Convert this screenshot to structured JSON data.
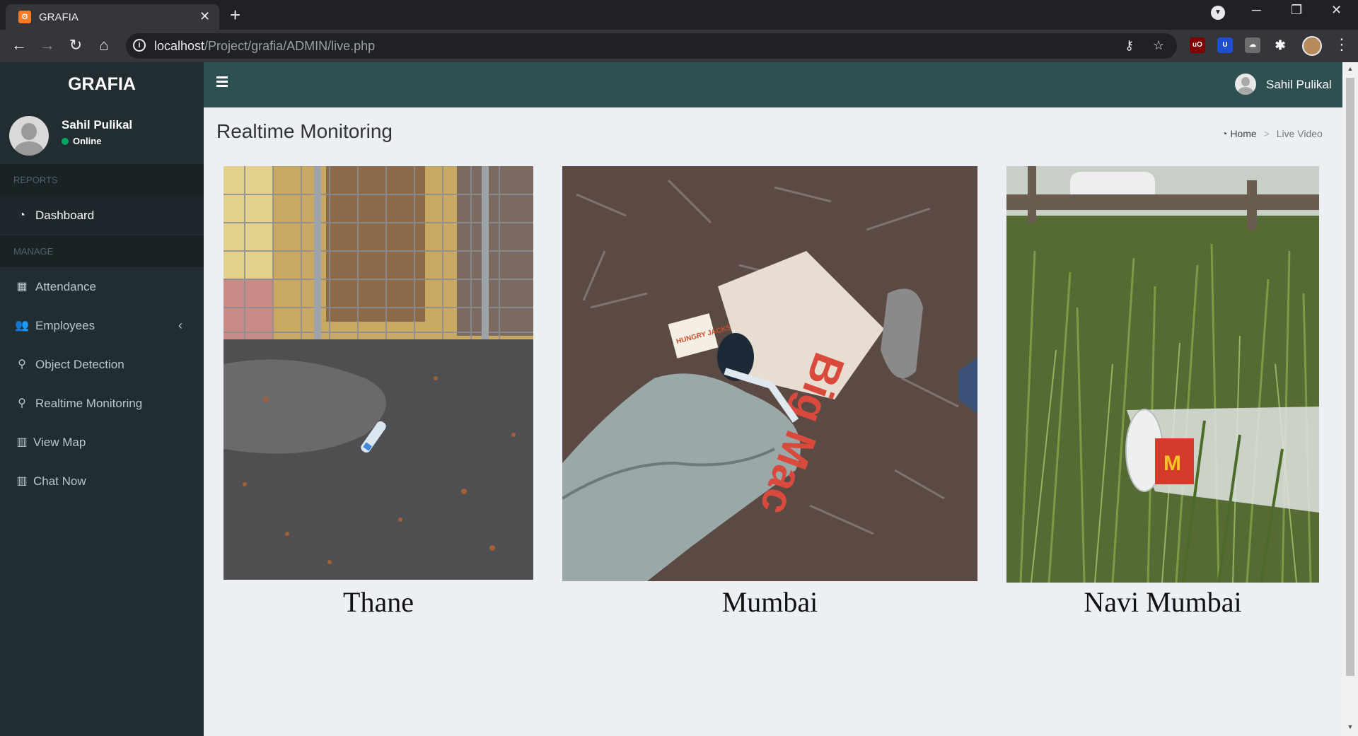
{
  "browser": {
    "tab_title": "GRAFIA",
    "tab_favicon_text": "ʘ",
    "url_host": "localhost",
    "url_path": "/Project/grafia/ADMIN/live.php"
  },
  "sidebar": {
    "brand": "GRAFIA",
    "user": {
      "name": "Sahil Pulikal",
      "status": "Online"
    },
    "sections": [
      {
        "header": "REPORTS"
      },
      {
        "header": "MANAGE"
      }
    ],
    "items": [
      {
        "label": "Dashboard",
        "icon": "dashboard-icon"
      },
      {
        "label": "Attendance",
        "icon": "calendar-icon"
      },
      {
        "label": "Employees",
        "icon": "users-icon"
      },
      {
        "label": "Object Detection",
        "icon": "map-marker-icon"
      },
      {
        "label": "Realtime Monitoring",
        "icon": "map-marker-icon"
      },
      {
        "label": "View Map",
        "icon": "bar-chart-icon"
      },
      {
        "label": "Chat Now",
        "icon": "bar-chart-icon"
      }
    ]
  },
  "topnav": {
    "username": "Sahil Pulikal"
  },
  "page": {
    "title": "Realtime Monitoring",
    "breadcrumb": {
      "home": "Home",
      "current": "Live Video"
    }
  },
  "cameras": [
    {
      "caption": "Thane"
    },
    {
      "caption": "Mumbai"
    },
    {
      "caption": "Navi Mumbai"
    }
  ],
  "photo_labels": {
    "bag_text": "Big Mac",
    "hungry": "HUNGRY JACKS"
  },
  "colors": {
    "sidebar": "#222d32",
    "topnav": "#2e5050",
    "content_bg": "#ecf0f5"
  }
}
